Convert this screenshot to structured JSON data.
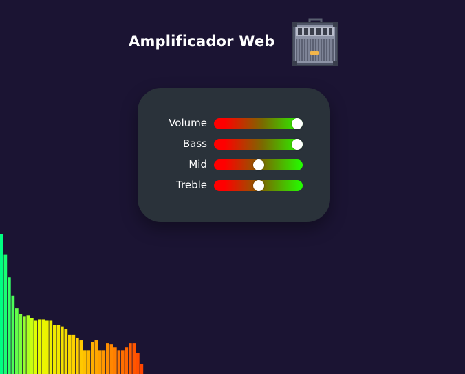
{
  "app": {
    "title": "Amplificador Web",
    "icon": "amplifier-icon"
  },
  "controls": [
    {
      "id": "volume",
      "label": "Volume",
      "value": 1.0
    },
    {
      "id": "bass",
      "label": "Bass",
      "value": 1.0
    },
    {
      "id": "mid",
      "label": "Mid",
      "value": 0.5
    },
    {
      "id": "treble",
      "label": "Treble",
      "value": 0.5
    }
  ],
  "colors": {
    "background": "#1b1433",
    "panel": "#2a323a",
    "slider_low": "#ff0000",
    "slider_high": "#22ff00",
    "thumb": "#ffffff"
  },
  "visualizer": {
    "levels": [
      1.0,
      0.85,
      0.69,
      0.56,
      0.47,
      0.43,
      0.41,
      0.42,
      0.4,
      0.38,
      0.39,
      0.39,
      0.38,
      0.38,
      0.35,
      0.35,
      0.34,
      0.32,
      0.28,
      0.28,
      0.26,
      0.24,
      0.17,
      0.17,
      0.23,
      0.24,
      0.17,
      0.17,
      0.22,
      0.21,
      0.19,
      0.17,
      0.17,
      0.19,
      0.22,
      0.22,
      0.15,
      0.07
    ]
  }
}
